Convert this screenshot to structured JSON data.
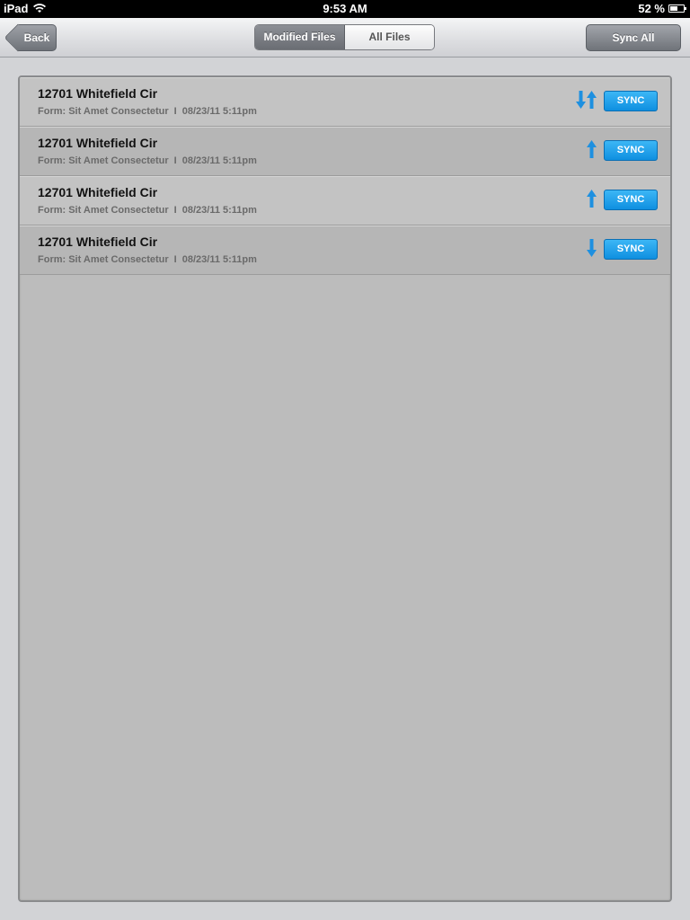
{
  "status_bar": {
    "carrier": "iPad",
    "time": "9:53 AM",
    "battery_percent": "52 %",
    "battery_level": 0.52
  },
  "nav": {
    "back_label": "Back",
    "segments": [
      "Modified Files",
      "All Files"
    ],
    "selected_segment": "Modified Files",
    "sync_all_label": "Sync All"
  },
  "files": [
    {
      "title": "12701 Whitefield Cir",
      "form": "Form: Sit Amet Consectetur",
      "separator": "I",
      "date": "08/23/11 5:11pm",
      "direction": "both",
      "sync_label": "SYNC"
    },
    {
      "title": "12701 Whitefield Cir",
      "form": "Form: Sit Amet Consectetur",
      "separator": "I",
      "date": "08/23/11 5:11pm",
      "direction": "up",
      "sync_label": "SYNC"
    },
    {
      "title": "12701 Whitefield Cir",
      "form": "Form: Sit Amet Consectetur",
      "separator": "I",
      "date": "08/23/11 5:11pm",
      "direction": "up",
      "sync_label": "SYNC"
    },
    {
      "title": "12701 Whitefield Cir",
      "form": "Form: Sit Amet Consectetur",
      "separator": "I",
      "date": "08/23/11 5:11pm",
      "direction": "down",
      "sync_label": "SYNC"
    }
  ],
  "colors": {
    "accent": "#1a9be8",
    "arrow": "#1e90e0"
  }
}
